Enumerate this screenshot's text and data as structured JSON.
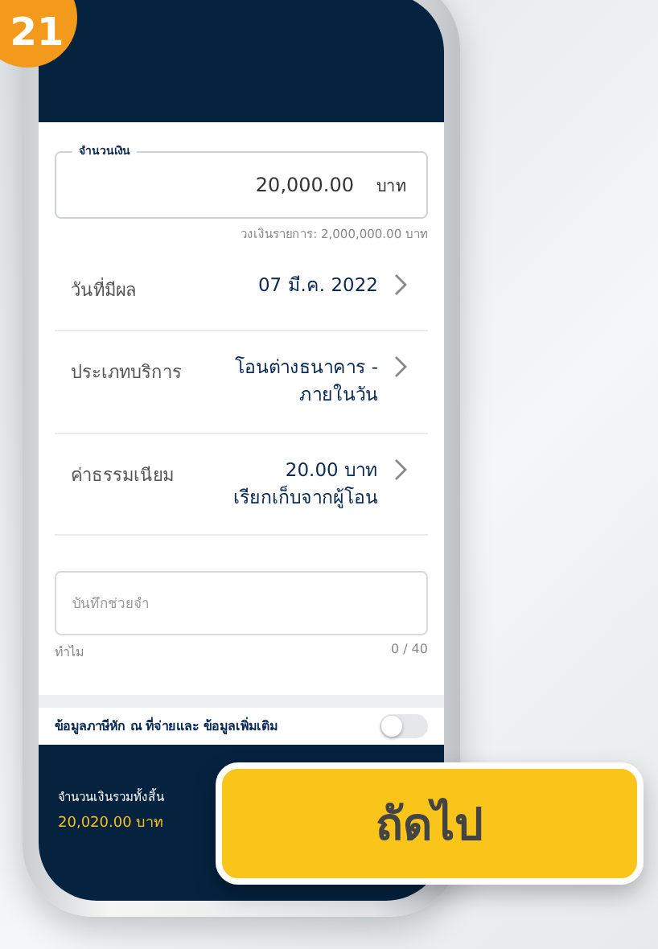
{
  "badge": "21",
  "amount_field": {
    "label": "จำนวนเงิน",
    "value": "20,000.00",
    "unit": "บาท",
    "helper": "วงเงินรายการ: 2,000,000.00 บาท"
  },
  "rows": [
    {
      "label": "วันที่มีผล",
      "value": "07 มี.ค. 2022"
    },
    {
      "label": "ประเภทบริการ",
      "value": "โอนต่างธนาคาร - ภายในวัน"
    },
    {
      "label": "ค่าธรรมเนียม",
      "value": "20.00 บาท",
      "note": "เรียกเก็บจากผู้โอน"
    }
  ],
  "memo_field": {
    "placeholder": "บันทึกช่วยจำ",
    "helper": "ทำไม",
    "counter": "0 / 40"
  },
  "tax_toggle": {
    "label": "ข้อมูลภาษีหัก ณ ที่จ่ายและ ข้อมูลเพิ่มเติม",
    "on": false
  },
  "footer": {
    "total_label": "จำนวนเงินรวมทั้งสิ้น",
    "total_value": "20,020.00 บาท"
  },
  "next_button": "ถัดไป"
}
